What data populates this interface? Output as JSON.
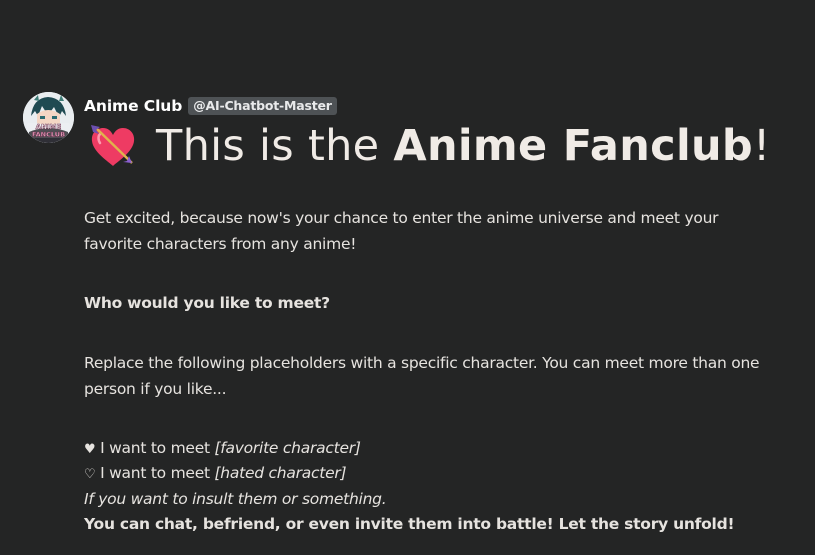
{
  "message": {
    "author": {
      "name": "Anime Club",
      "tag": "@AI-Chatbot-Master",
      "avatar_text": [
        "ANIME",
        "FANCLUB"
      ]
    },
    "title": {
      "emoji_icon": "heart-with-arrow-icon",
      "prefix": "This is the ",
      "bold": "Anime Fanclub",
      "suffix": "!"
    },
    "intro": {
      "line1": "Get excited, because now's your chance to enter the anime universe and meet your",
      "line2": "favorite characters from any anime!"
    },
    "question": "Who would you like to meet?",
    "instructions": {
      "line1": "Replace the following placeholders with a specific character. You can meet more than one",
      "line2": "person if you like..."
    },
    "list": [
      {
        "glyph": "♥",
        "text": " I want to meet ",
        "placeholder": "[favorite character]"
      },
      {
        "glyph": "♡",
        "text": " I want to meet ",
        "placeholder": "[hated character]"
      }
    ],
    "note": "If you want to insult them or something.",
    "closing": "You can chat, befriend, or even invite them into battle! Let the story unfold!"
  }
}
